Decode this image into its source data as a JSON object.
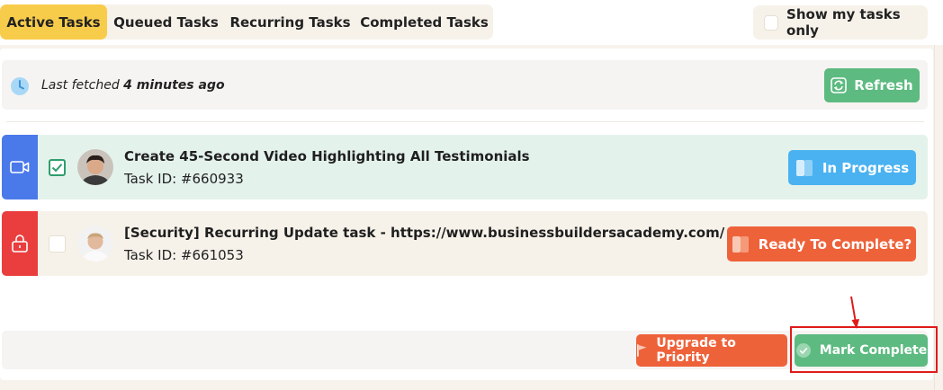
{
  "tabs": [
    {
      "label": "Active Tasks",
      "active": true
    },
    {
      "label": "Queued Tasks",
      "active": false
    },
    {
      "label": "Recurring Tasks",
      "active": false
    },
    {
      "label": "Completed Tasks",
      "active": false
    }
  ],
  "filter": {
    "show_my_tasks_label": "Show my tasks only",
    "checked": false
  },
  "fetch": {
    "prefix": "Last fetched",
    "time": "4 minutes ago",
    "refresh_label": "Refresh"
  },
  "tasks": [
    {
      "title": "Create 45-Second Video Highlighting All Testimonials",
      "id_text": "Task ID: #660933",
      "type_icon": "video-icon",
      "checked": true,
      "status_label": "In Progress",
      "colors": {
        "stripe": "#4a79ea",
        "row_bg": "#e4f2ec",
        "status": "#4ab2f1"
      }
    },
    {
      "title": "[Security] Recurring Update task - https://www.businessbuildersacademy.com/",
      "id_text": "Task ID: #661053",
      "type_icon": "lock-icon",
      "checked": false,
      "status_label": "Ready To Complete?",
      "colors": {
        "stripe": "#ea3e3e",
        "row_bg": "#f6f2ea",
        "status": "#ee623a"
      }
    }
  ],
  "actions": {
    "upgrade_label": "Upgrade to Priority",
    "mark_complete_label": "Mark Complete"
  },
  "colors": {
    "accent_tab": "#f8cc4b",
    "green": "#5dba80",
    "orange": "#ee623a",
    "annotation_red": "#e01b1b"
  }
}
